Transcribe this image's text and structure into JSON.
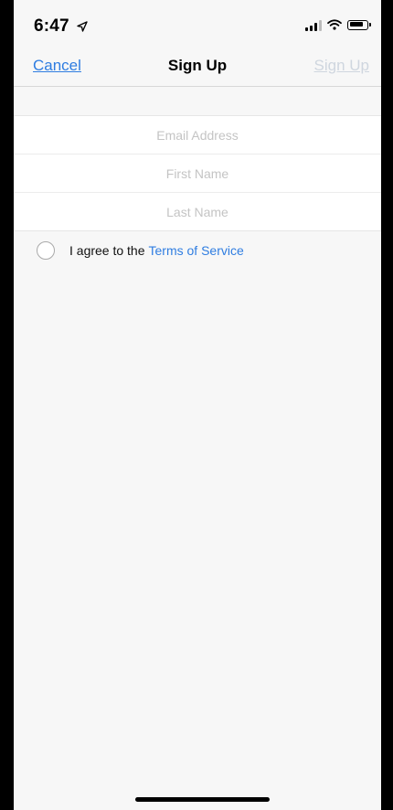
{
  "status_bar": {
    "time": "6:47"
  },
  "nav": {
    "cancel_label": "Cancel",
    "title": "Sign Up",
    "signup_label": "Sign Up"
  },
  "form": {
    "email_placeholder": "Email Address",
    "first_name_placeholder": "First Name",
    "last_name_placeholder": "Last Name"
  },
  "agreement": {
    "text": "I agree to the",
    "link_text": "Terms of Service",
    "checked": false
  },
  "colors": {
    "accent": "#2f7de1",
    "disabled": "#cfd6df",
    "background": "#f7f7f7"
  }
}
